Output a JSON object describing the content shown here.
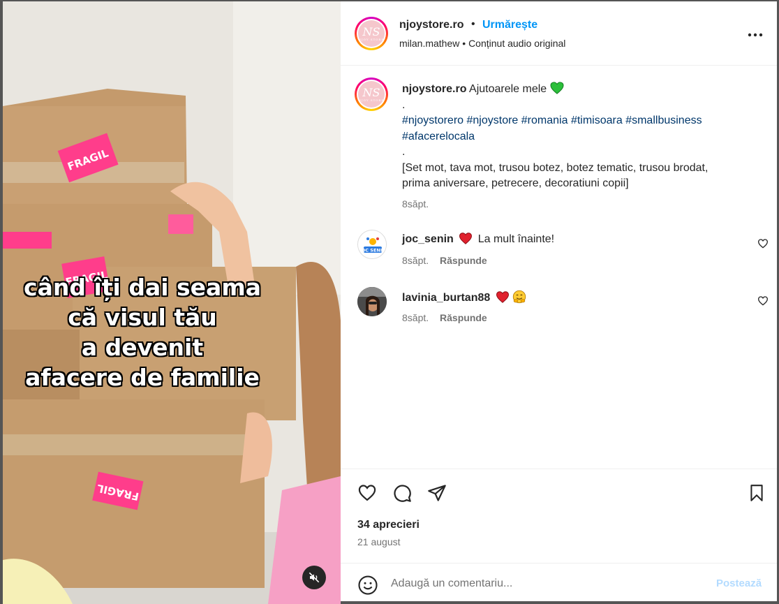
{
  "media": {
    "overlay_lines": [
      "când îți dai seama",
      "că visul tău",
      "a devenit",
      "afacere de familie"
    ],
    "sticker_text": "FRAGIL"
  },
  "header": {
    "username": "njoystore.ro",
    "separator": "•",
    "follow_label": "Urmărește",
    "audio_user": "milan.mathew",
    "audio_sep": "•",
    "audio_label": "Conținut audio original",
    "avatar_initials": "NS",
    "avatar_sub": "NJOY STORE"
  },
  "caption": {
    "username": "njoystore.ro",
    "text": "Ajutoarele mele",
    "dot1": ".",
    "hashtags_line1": [
      "#njoystorero",
      "#njoystore",
      "#romania",
      "#timisoara",
      "#smallbusiness"
    ],
    "hashtags_line2": [
      "#afacerelocala"
    ],
    "dot2": ".",
    "body_line1": "[Set mot, tava mot, trusou botez, botez tematic, trusou brodat,",
    "body_line2": "prima aniversare, petrecere, decoratiuni copii]",
    "time": "8săpt."
  },
  "comments": [
    {
      "username": "joc_senin",
      "text": "La mult înainte!",
      "time": "8săpt.",
      "reply": "Răspunde",
      "avatar_text": "JOC SENIN"
    },
    {
      "username": "lavinia_burtan88",
      "text": "",
      "time": "8săpt.",
      "reply": "Răspunde"
    }
  ],
  "actions": {
    "likes": "34 aprecieri",
    "date": "21 august"
  },
  "comment_bar": {
    "placeholder": "Adaugă un comentariu...",
    "post_label": "Postează"
  },
  "colors": {
    "accent": "#0095f6",
    "hashtag": "#00376b",
    "muted": "#737373",
    "post_disabled": "#b3dbff",
    "sticker_pink": "#ff3d8b"
  },
  "icons": [
    "mute-icon",
    "more-icon",
    "green-heart-icon",
    "red-heart-icon",
    "smile-emoji-icon",
    "like-icon",
    "comment-icon",
    "share-icon",
    "save-icon",
    "emoji-icon"
  ]
}
